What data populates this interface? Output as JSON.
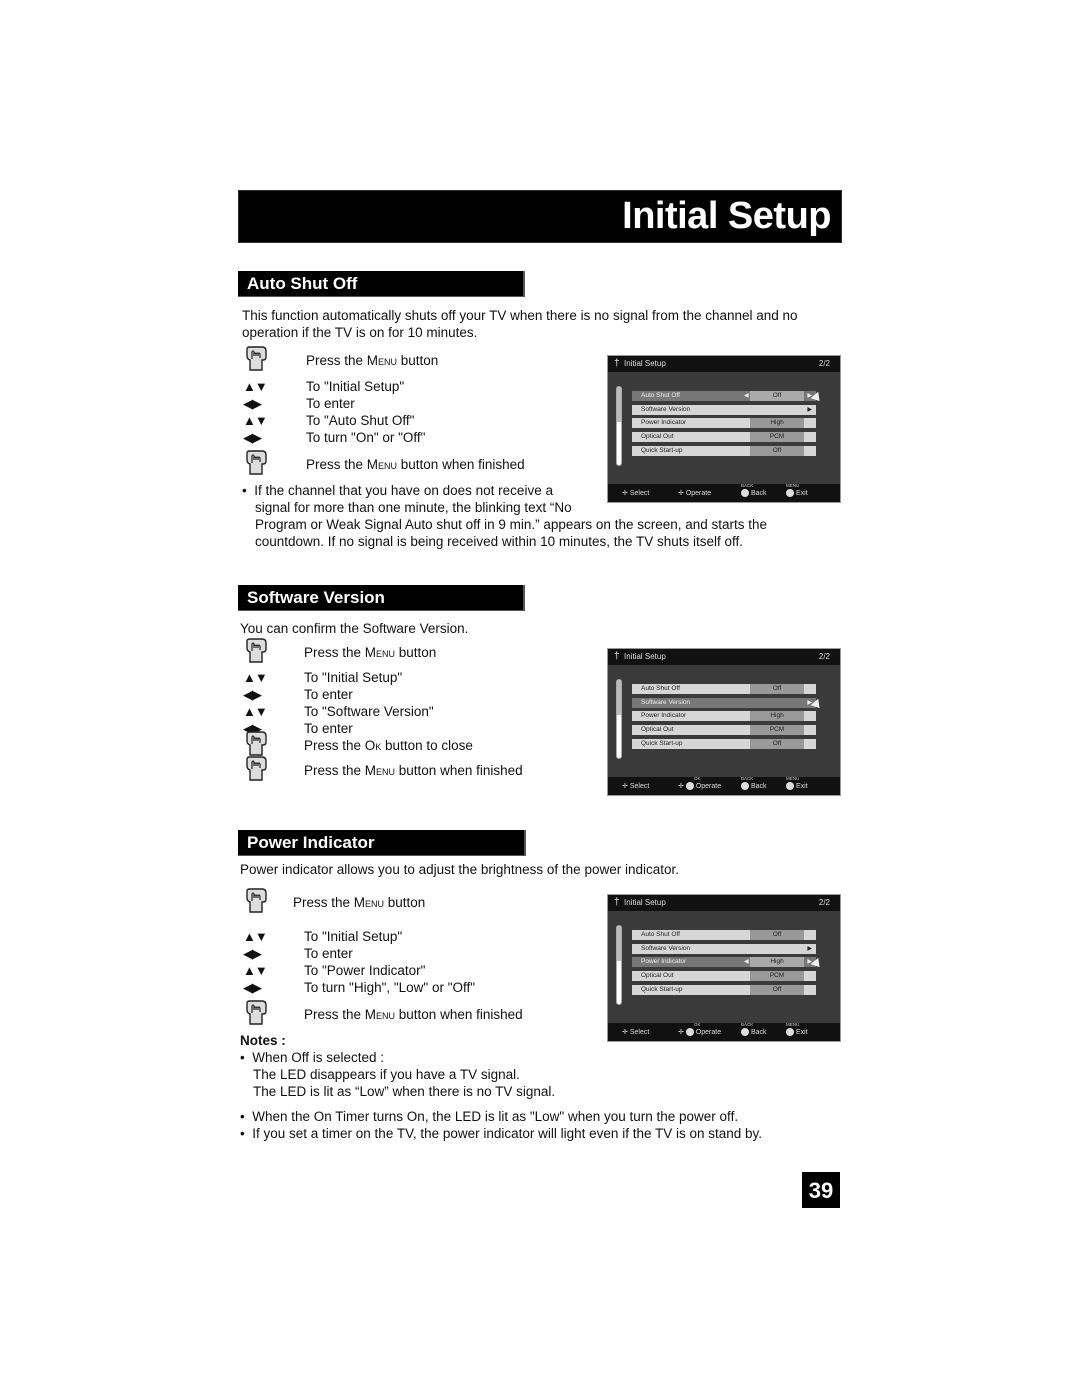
{
  "page_title": "Initial Setup",
  "page_number": "39",
  "sections": {
    "auto_shut_off": {
      "heading": "Auto Shut Off",
      "intro_line1": "This function automatically shuts off your TV when there is no signal from the channel and no",
      "intro_line2": "operation if the TV is on for 10 minutes.",
      "steps": [
        {
          "icon": "hand-press-icon",
          "pre": "Press the ",
          "key": "Menu",
          "post": " button"
        },
        {
          "icon": "up-down-arrows-icon",
          "text": "To \"Initial Setup\""
        },
        {
          "icon": "left-right-arrows-icon",
          "text": "To enter"
        },
        {
          "icon": "up-down-arrows-icon",
          "text": "To \"Auto Shut Off\""
        },
        {
          "icon": "left-right-arrows-icon",
          "text": "To turn \"On\" or \"Off\""
        },
        {
          "icon": "hand-press-icon",
          "pre": "Press the ",
          "key": "Menu",
          "post": " button when finished"
        }
      ],
      "bullet_line1": "If the channel that you have on does not receive a",
      "bullet_line2": "signal for more than one minute, the blinking text “No",
      "bullet_line3": "Program or Weak Signal Auto shut off in 9 min.” appears on the screen, and starts the",
      "bullet_line4": "countdown. If no signal is being received within 10 minutes, the TV shuts itself off."
    },
    "software_version": {
      "heading": "Software Version",
      "intro": "You can confirm the Software Version.",
      "steps": [
        {
          "icon": "hand-press-icon",
          "pre": "Press the ",
          "key": "Menu",
          "post": " button"
        },
        {
          "icon": "up-down-arrows-icon",
          "text": "To \"Initial Setup\""
        },
        {
          "icon": "left-right-arrows-icon",
          "text": "To enter"
        },
        {
          "icon": "up-down-arrows-icon",
          "text": "To \"Software Version\""
        },
        {
          "icon": "left-right-arrows-icon",
          "text": "To enter"
        },
        {
          "icon": "hand-press-icon",
          "pre": "Press the ",
          "key": "Ok",
          "post": " button to close"
        },
        {
          "icon": "hand-press-icon",
          "pre": "Press the ",
          "key": "Menu",
          "post": " button when finished"
        }
      ]
    },
    "power_indicator": {
      "heading": "Power Indicator",
      "intro": "Power indicator allows you to adjust the brightness of the power indicator.",
      "steps": [
        {
          "icon": "hand-press-icon",
          "pre": "Press the ",
          "key": "Menu",
          "post": " button"
        },
        {
          "icon": "up-down-arrows-icon",
          "text": "To \"Initial Setup\""
        },
        {
          "icon": "left-right-arrows-icon",
          "text": "To enter"
        },
        {
          "icon": "up-down-arrows-icon",
          "text": "To \"Power Indicator\""
        },
        {
          "icon": "left-right-arrows-icon",
          "text": "To turn \"High\", \"Low\" or \"Off\""
        },
        {
          "icon": "hand-press-icon",
          "pre": "Press the ",
          "key": "Menu",
          "post": " button when finished"
        }
      ],
      "notes_label": "Notes :",
      "note1_line1": "When Off is selected :",
      "note1_line2": "The LED disappears if you have a TV signal.",
      "note1_line3": "The LED is lit as “Low” when there is no TV signal.",
      "note2": "When the On Timer turns On, the LED is lit as \"Low\" when you turn the power off.",
      "note3": "If you set a timer on the TV, the power indicator will light even if the TV is on stand by."
    }
  },
  "tv_menu": {
    "title": "Initial Setup",
    "page": "2/2",
    "rows": [
      {
        "label": "Auto Shut Off",
        "value": "Off"
      },
      {
        "label": "Software Version",
        "value": ""
      },
      {
        "label": "Power Indicator",
        "value": "High"
      },
      {
        "label": "Optical Out",
        "value": "PCM"
      },
      {
        "label": "Quick Start-up",
        "value": "Off"
      }
    ],
    "footer": {
      "select": "Select",
      "operate": "Operate",
      "back": "Back",
      "exit": "Exit",
      "ok_tag": "OK",
      "back_tag": "BACK",
      "menu_tag": "MENU"
    },
    "selected_rows": {
      "screen1": 0,
      "screen2": 1,
      "screen3": 2
    }
  },
  "glyphs": {
    "up_down": "▲▼",
    "left_right": "◀▶",
    "bullet": "•",
    "arrow_left": "◀",
    "arrow_right": "▶",
    "wrench": "Ψ"
  }
}
